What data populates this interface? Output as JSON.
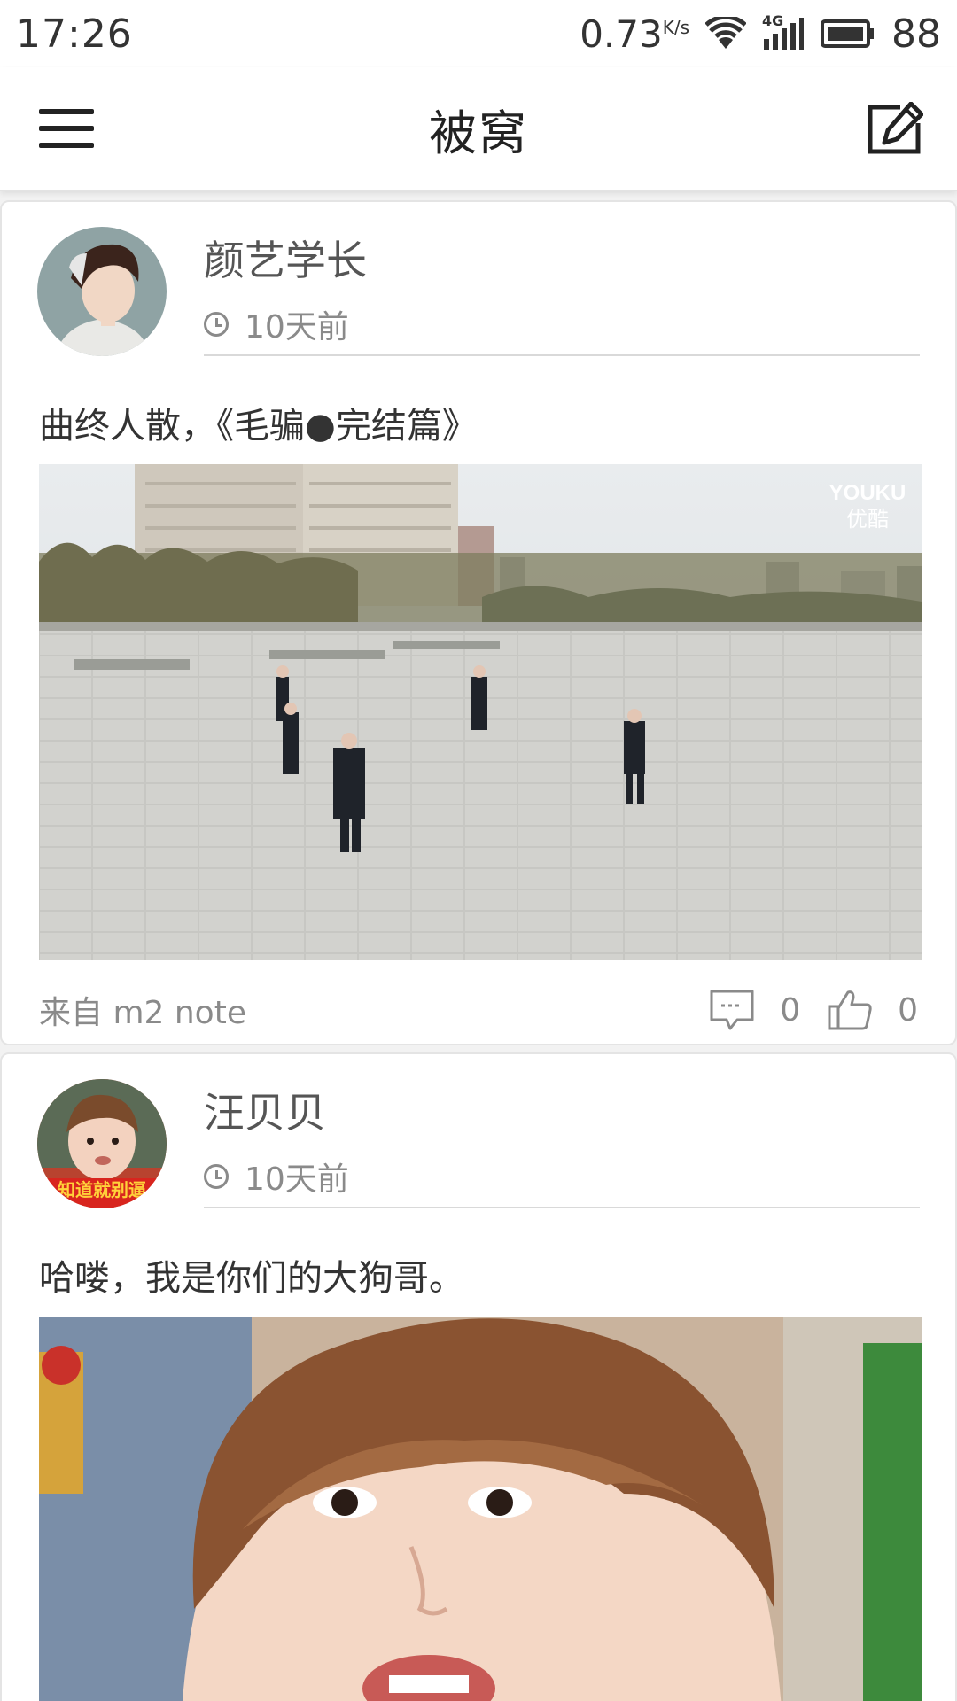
{
  "status_bar": {
    "time": "17:26",
    "net_speed": "0.73",
    "net_unit": "K/s",
    "signal_label": "4G",
    "battery": "88"
  },
  "appbar": {
    "title": "被窝",
    "menu_icon": "hamburger-menu-icon",
    "edit_icon": "compose-icon"
  },
  "posts": [
    {
      "author": "颜艺学长",
      "time": "10天前",
      "text": "曲终人散，《毛骗●完结篇》",
      "image_watermark_1": "YOUKU",
      "image_watermark_2": "优酷",
      "source": "来自 m2 note",
      "comments": "0",
      "likes": "0"
    },
    {
      "author": "汪贝贝",
      "time": "10天前",
      "text": "哈喽，我是你们的大狗哥。",
      "avatar_caption": "知道就别逼"
    }
  ],
  "colors": {
    "background": "#f2f2f2",
    "card": "#ffffff",
    "text_muted": "#8a8a8a"
  }
}
